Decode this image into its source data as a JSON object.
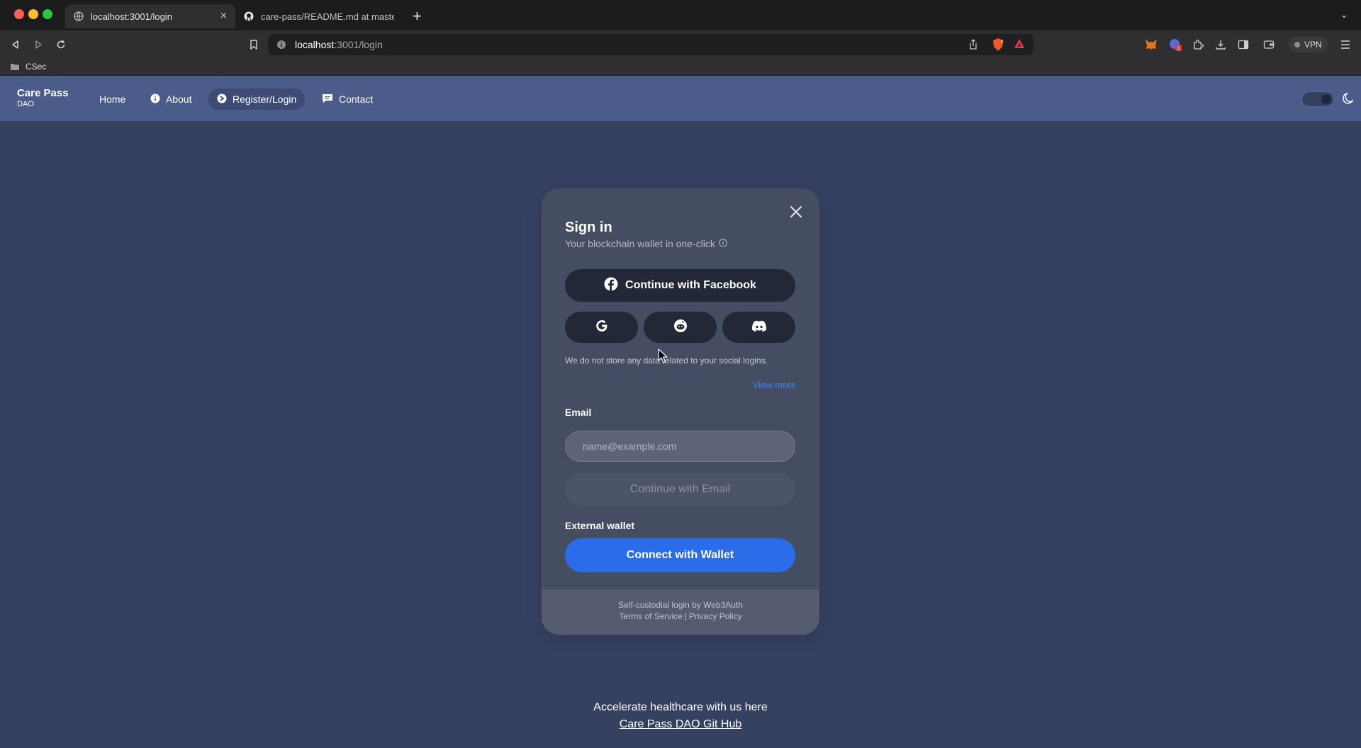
{
  "browser": {
    "tabs": [
      {
        "title": "localhost:3001/login",
        "active": true
      },
      {
        "title": "care-pass/README.md at master · ",
        "active": false
      }
    ],
    "url_host": "localhost",
    "url_path": ":3001/login",
    "bookmarks": [
      {
        "label": "CSec",
        "icon": "folder-icon"
      }
    ],
    "vpn_label": "VPN"
  },
  "site": {
    "brand_name": "Care Pass",
    "brand_sub": "DAO",
    "nav": [
      {
        "label": "Home",
        "icon": ""
      },
      {
        "label": "About",
        "icon": "info-icon"
      },
      {
        "label": "Register/Login",
        "icon": "login-icon",
        "active": true
      },
      {
        "label": "Contact",
        "icon": "chat-icon"
      }
    ],
    "theme_toggle": "dark"
  },
  "modal": {
    "title": "Sign in",
    "subtitle": "Your blockchain wallet in one-click",
    "facebook_label": "Continue with Facebook",
    "social_icons": [
      "google-icon",
      "reddit-icon",
      "discord-icon"
    ],
    "privacy_note": "We do not store any data related to your social logins.",
    "view_more": "View more",
    "email_label": "Email",
    "email_placeholder": "name@example.com",
    "email_button": "Continue with Email",
    "wallet_label": "External wallet",
    "wallet_button": "Connect with Wallet",
    "footer_line1": "Self-custodial login by Web3Auth",
    "terms": "Terms of Service",
    "privacy": "Privacy Policy"
  },
  "footer": {
    "text": "Accelerate healthcare with us here",
    "link": "Care Pass DAO Git Hub"
  },
  "colors": {
    "page_bg": "#364161",
    "nav_bg": "#4b5b8a",
    "modal_bg": "#454d63",
    "primary": "#2b6de8"
  }
}
